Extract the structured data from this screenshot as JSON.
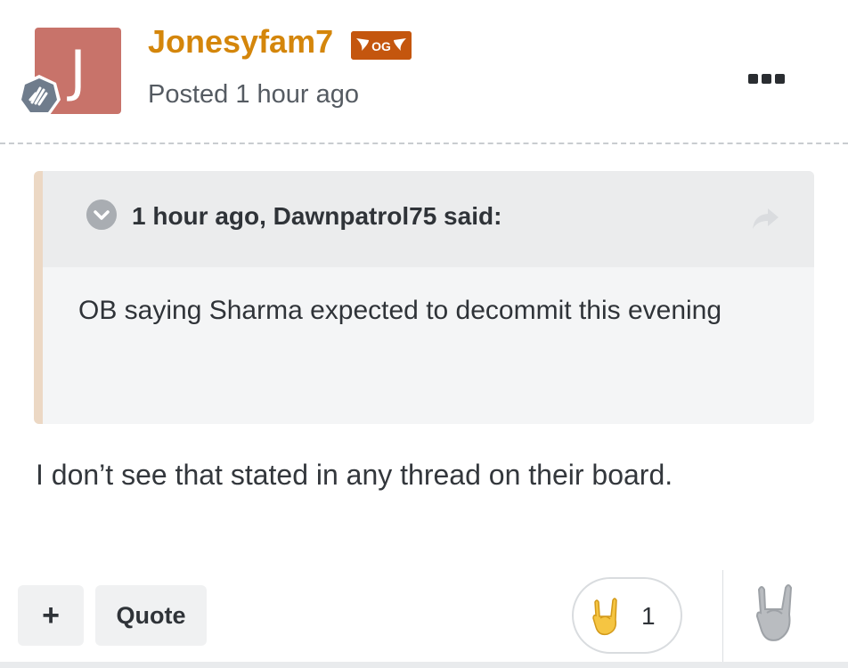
{
  "post": {
    "avatar_letter": "J",
    "username": "Jonesyfam7",
    "badge_text": "OG",
    "posted": "Posted 1 hour ago"
  },
  "quote": {
    "author_line": "1 hour ago, Dawnpatrol75 said:",
    "text": "OB saying Sharma expected to decommit this evening"
  },
  "body": {
    "text": "I don’t see that stated in any thread on their board."
  },
  "actions": {
    "plus_label": "+",
    "quote_label": "Quote",
    "reaction_count": "1"
  },
  "colors": {
    "username": "#d4860b",
    "avatar_bg": "#c8736a",
    "og_badge": "#c4560e",
    "quote_accent": "#ecd8c4"
  },
  "icons": {
    "rank": "hand-wave-badge-icon",
    "menu": "more-options-icon",
    "collapse": "chevron-down-icon",
    "share": "share-arrow-icon",
    "reaction": "rock-on-hand-icon"
  }
}
